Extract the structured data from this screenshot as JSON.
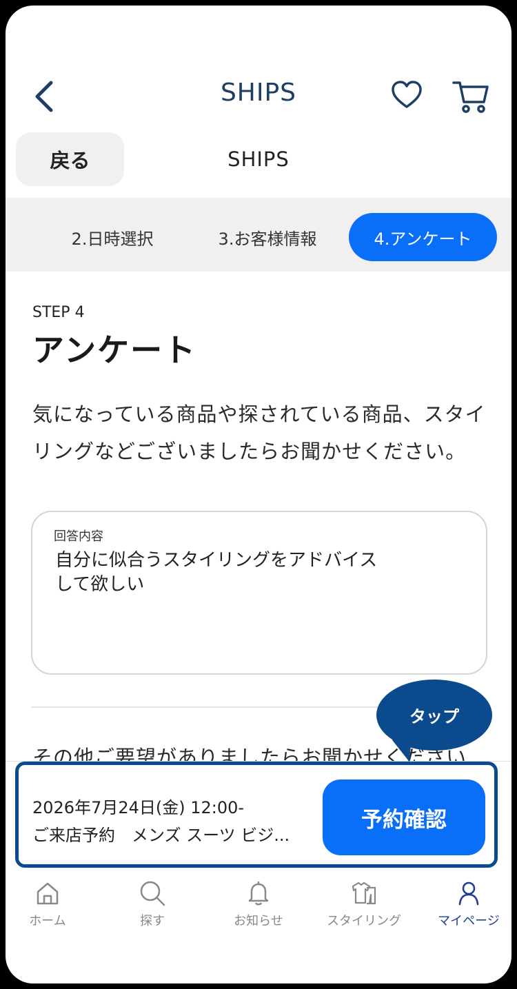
{
  "header": {
    "logo": "SHIPS",
    "back_icon": "chevron-left-icon",
    "favorite_icon": "heart-icon",
    "cart_icon": "cart-icon"
  },
  "subheader": {
    "back_label": "戻る",
    "title": "SHIPS"
  },
  "steps": [
    {
      "label": "2.日時選択",
      "active": false
    },
    {
      "label": "3.お客様情報",
      "active": false
    },
    {
      "label": "4.アンケート",
      "active": true
    }
  ],
  "content": {
    "step_label": "STEP 4",
    "heading": "アンケート",
    "description": "気になっている商品や探されている商品、スタイリングなどございましたらお聞かせください。",
    "answer_label": "回答内容",
    "answer_value": "自分に似合うスタイリングをアドバイス\nして欲しい",
    "next_question": "その他ご要望がありましたらお聞かせください"
  },
  "tooltip": {
    "label": "タップ"
  },
  "reservation": {
    "datetime": "2026年7月24日(金) 12:00-",
    "summary": "ご来店予約　メンズ スーツ ビジ...",
    "confirm_label": "予約確認"
  },
  "tabbar": [
    {
      "label": "ホーム",
      "icon": "home-icon",
      "active": false
    },
    {
      "label": "探す",
      "icon": "search-icon",
      "active": false
    },
    {
      "label": "お知らせ",
      "icon": "bell-icon",
      "active": false
    },
    {
      "label": "スタイリング",
      "icon": "clothing-icon",
      "active": false
    },
    {
      "label": "マイページ",
      "icon": "person-icon",
      "active": true
    }
  ],
  "colors": {
    "accent": "#0a6ff8",
    "navy": "#0b4a8c",
    "logo": "#1d3f63",
    "tab_active": "#1e3f8f"
  }
}
